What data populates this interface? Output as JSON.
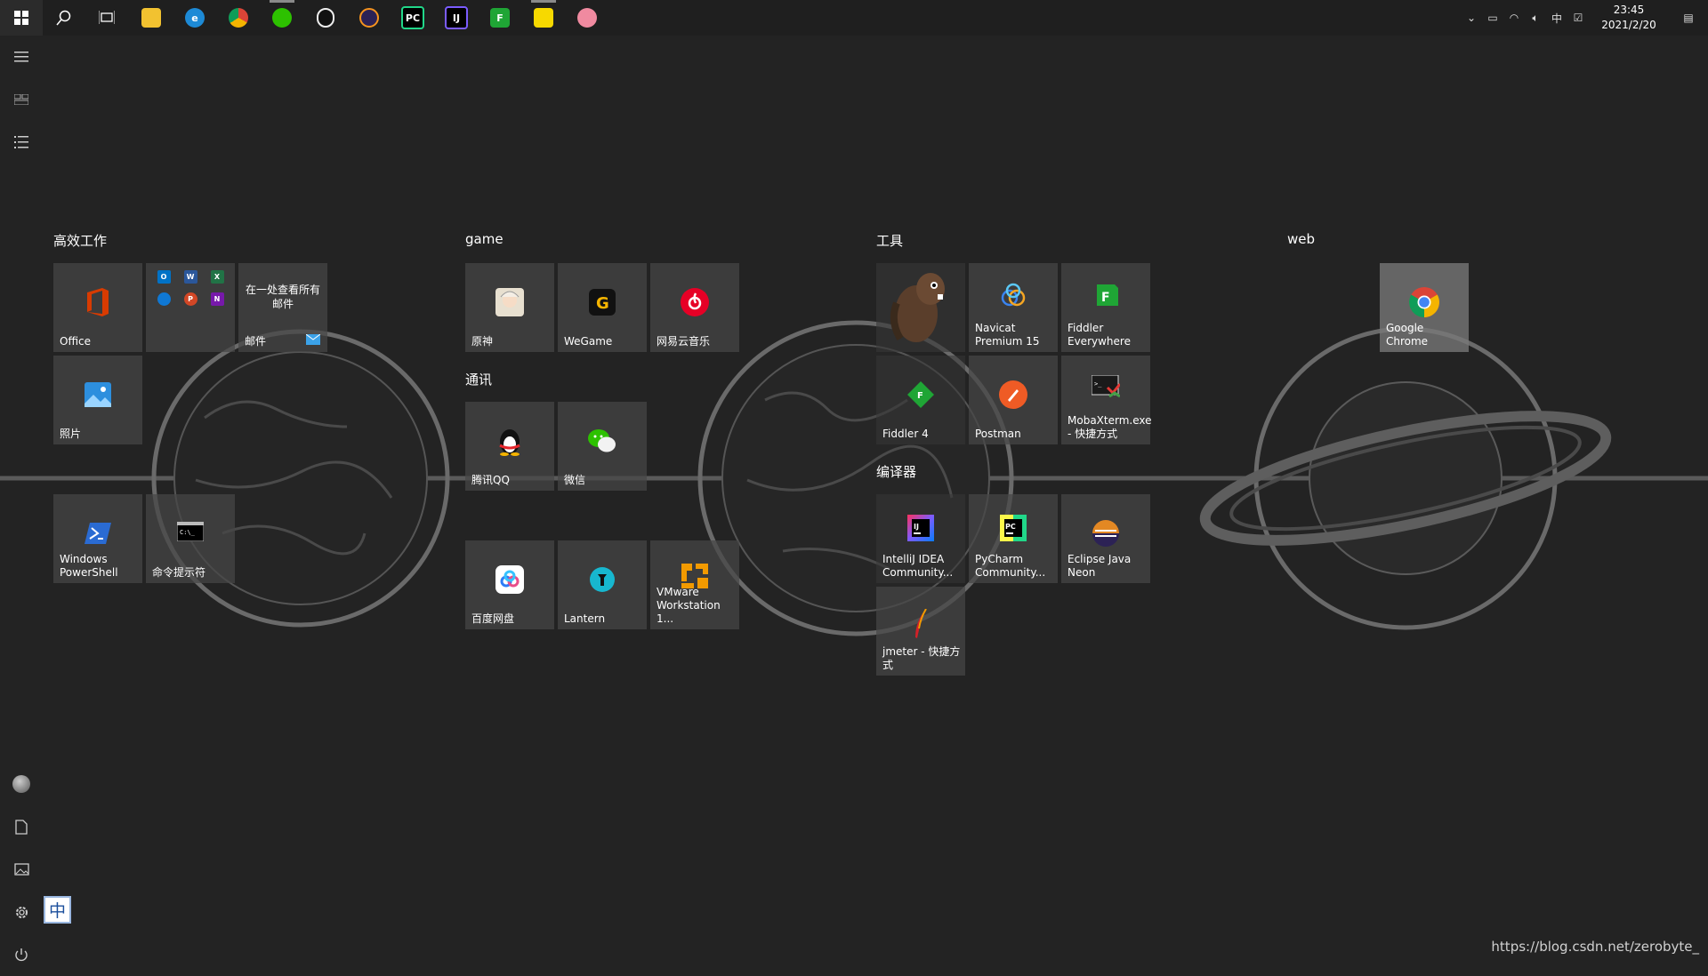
{
  "taskbar": {
    "apps": [
      {
        "name": "file-explorer",
        "label": ""
      },
      {
        "name": "edge",
        "label": "e"
      },
      {
        "name": "chrome",
        "label": ""
      },
      {
        "name": "wechat",
        "label": ""
      },
      {
        "name": "qq",
        "label": ""
      },
      {
        "name": "eclipse",
        "label": ""
      },
      {
        "name": "pycharm",
        "label": "PC"
      },
      {
        "name": "intellij",
        "label": "IJ"
      },
      {
        "name": "fiddler",
        "label": "F"
      },
      {
        "name": "sticky-notes",
        "label": ""
      },
      {
        "name": "pig-app",
        "label": ""
      }
    ],
    "ime_indicator": "中",
    "time": "23:45",
    "date": "2021/2/20"
  },
  "groups": {
    "productivity": "高效工作",
    "game": "game",
    "comm": "通讯",
    "tools": "工具",
    "compilers": "编译器",
    "web": "web"
  },
  "tiles": {
    "office": "Office",
    "mail_heading": "在一处查看所有邮件",
    "mail": "邮件",
    "photos": "照片",
    "powershell": "Windows PowerShell",
    "cmd": "命令提示符",
    "yuanshen": "原神",
    "wegame": "WeGame",
    "netease_music": "网易云音乐",
    "qq": "腾讯QQ",
    "wechat": "微信",
    "baidu_disk": "百度网盘",
    "lantern": "Lantern",
    "vmware": "VMware Workstation 1...",
    "navicat": "Navicat Premium 15",
    "fiddler_everywhere": "Fiddler Everywhere",
    "fiddler4": "Fiddler 4",
    "postman": "Postman",
    "mobaxterm": "MobaXterm.exe - 快捷方式",
    "intellij": "IntelliJ IDEA Community...",
    "pycharm": "PyCharm Community...",
    "eclipse": "Eclipse Java Neon",
    "jmeter": "jmeter - 快捷方式",
    "chrome": "Google Chrome"
  },
  "ime_box": "中",
  "watermark": "https://blog.csdn.net/zerobyte_",
  "colors": {
    "background": "#232323",
    "tile": "#464646",
    "taskbar": "#1f1f1f"
  }
}
